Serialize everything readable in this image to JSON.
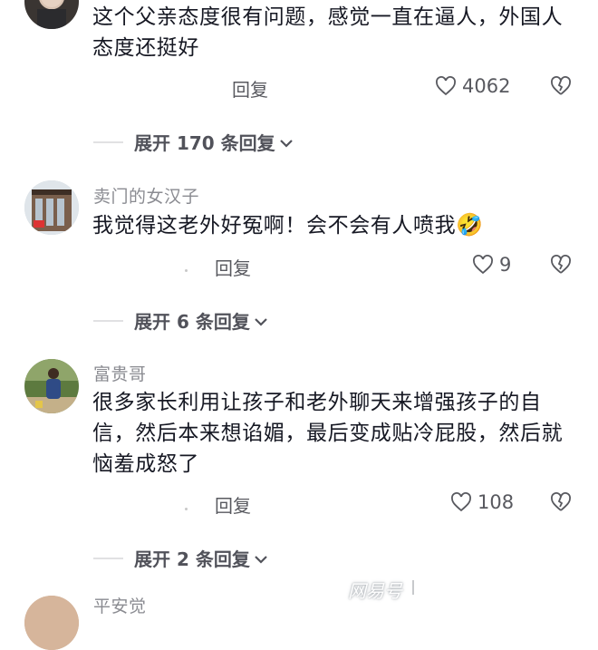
{
  "comments": [
    {
      "text": "这个父亲态度很有问题，感觉一直在逼人，外国人态度还挺好",
      "reply_label": "回复",
      "likes": "4062",
      "expand_label": "展开 170 条回复"
    },
    {
      "username": "卖门的女汉子",
      "text": "我觉得这老外好冤啊！会不会有人喷我",
      "emoji": "🤣",
      "reply_label": "回复",
      "likes": "9",
      "expand_label": "展开 6 条回复"
    },
    {
      "username": "富贵哥",
      "text": "很多家长利用让孩子和老外聊天来增强孩子的自信，然后本来想谄媚，最后变成贴冷屁股，然后就恼羞成怒了",
      "reply_label": "回复",
      "likes": "108",
      "expand_label": "展开 2 条回复"
    },
    {
      "username": "平安觉"
    }
  ],
  "watermark": "网易号",
  "colors": {
    "text": "#161823",
    "secondary": "#8a8b91",
    "icon": "#58595f"
  }
}
